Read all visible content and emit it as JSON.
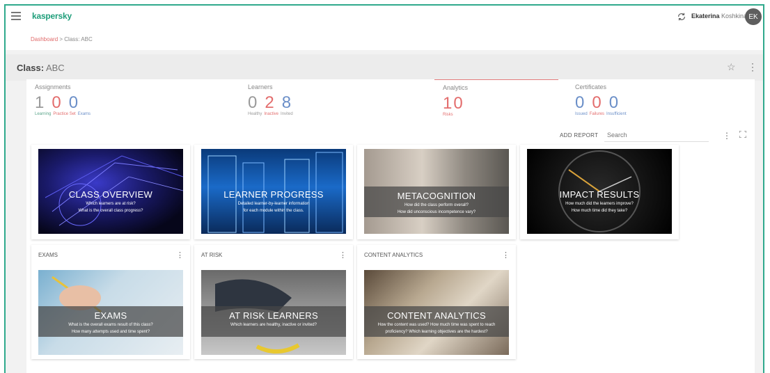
{
  "app": {
    "logo": "kaspersky"
  },
  "user": {
    "first": "Ekaterina",
    "last": "Koshkina",
    "initials": "EK"
  },
  "breadcrumb": {
    "link": "Dashboard",
    "sep": ">",
    "current": "Class: ABC"
  },
  "class": {
    "prefix": "Class:",
    "name": "ABC"
  },
  "stats": [
    {
      "title": "Assignments",
      "nums": [
        "1",
        "0",
        "0"
      ],
      "labels": [
        "Learning",
        "Practice Set",
        "Exams"
      ]
    },
    {
      "title": "Learners",
      "nums": [
        "0",
        "2",
        "8"
      ],
      "labels": [
        "Healthy",
        "Inactive",
        "Invited"
      ]
    },
    {
      "title": "Analytics",
      "nums": [
        "10"
      ],
      "labels": [
        "Risks"
      ]
    },
    {
      "title": "Certificates",
      "nums": [
        "0",
        "0",
        "0"
      ],
      "labels": [
        "Issued",
        "Failures",
        "Insufficient"
      ]
    }
  ],
  "toolbar": {
    "add_report": "ADD REPORT",
    "search_placeholder": "Search"
  },
  "cards": [
    {
      "header": "",
      "title": "CLASS OVERVIEW",
      "line1": "Which learners are at risk?",
      "line2": "What is the overall class progress?"
    },
    {
      "header": "",
      "title": "LEARNER PROGRESS",
      "line1": "Detailed learner-by-learner information",
      "line2": "for each module within the class."
    },
    {
      "header": "",
      "title": "METACOGNITION",
      "line1": "How did the class perform overall?",
      "line2": "How did unconscious incompetence vary?"
    },
    {
      "header": "",
      "title": "IMPACT RESULTS",
      "line1": "How much did the learners improve?",
      "line2": "How much time did they take?"
    },
    {
      "header": "EXAMS",
      "title": "EXAMS",
      "line1": "What is the overall exams result of this class?",
      "line2": "How many attempts used and time spent?"
    },
    {
      "header": "AT RISK",
      "title": "AT RISK LEARNERS",
      "line1": "Which learners are healthy, inactive or invited?",
      "line2": ""
    },
    {
      "header": "CONTENT ANALYTICS",
      "title": "CONTENT ANALYTICS",
      "line1": "How the content was used? How much time was spent to reach",
      "line2": "proficiency? Which learning objectives are the hardest?"
    }
  ]
}
